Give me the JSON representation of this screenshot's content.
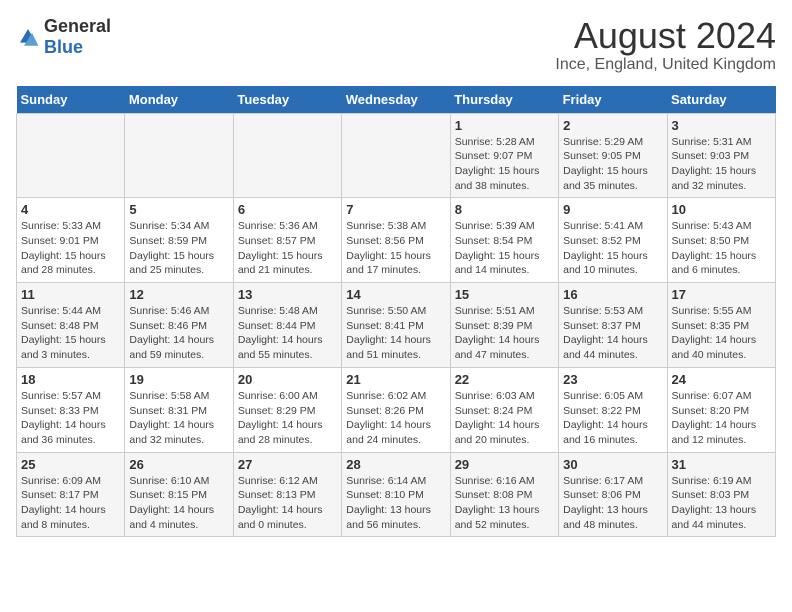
{
  "logo": {
    "general": "General",
    "blue": "Blue"
  },
  "title": "August 2024",
  "subtitle": "Ince, England, United Kingdom",
  "days_header": [
    "Sunday",
    "Monday",
    "Tuesday",
    "Wednesday",
    "Thursday",
    "Friday",
    "Saturday"
  ],
  "weeks": [
    [
      {
        "num": "",
        "info": ""
      },
      {
        "num": "",
        "info": ""
      },
      {
        "num": "",
        "info": ""
      },
      {
        "num": "",
        "info": ""
      },
      {
        "num": "1",
        "info": "Sunrise: 5:28 AM\nSunset: 9:07 PM\nDaylight: 15 hours\nand 38 minutes."
      },
      {
        "num": "2",
        "info": "Sunrise: 5:29 AM\nSunset: 9:05 PM\nDaylight: 15 hours\nand 35 minutes."
      },
      {
        "num": "3",
        "info": "Sunrise: 5:31 AM\nSunset: 9:03 PM\nDaylight: 15 hours\nand 32 minutes."
      }
    ],
    [
      {
        "num": "4",
        "info": "Sunrise: 5:33 AM\nSunset: 9:01 PM\nDaylight: 15 hours\nand 28 minutes."
      },
      {
        "num": "5",
        "info": "Sunrise: 5:34 AM\nSunset: 8:59 PM\nDaylight: 15 hours\nand 25 minutes."
      },
      {
        "num": "6",
        "info": "Sunrise: 5:36 AM\nSunset: 8:57 PM\nDaylight: 15 hours\nand 21 minutes."
      },
      {
        "num": "7",
        "info": "Sunrise: 5:38 AM\nSunset: 8:56 PM\nDaylight: 15 hours\nand 17 minutes."
      },
      {
        "num": "8",
        "info": "Sunrise: 5:39 AM\nSunset: 8:54 PM\nDaylight: 15 hours\nand 14 minutes."
      },
      {
        "num": "9",
        "info": "Sunrise: 5:41 AM\nSunset: 8:52 PM\nDaylight: 15 hours\nand 10 minutes."
      },
      {
        "num": "10",
        "info": "Sunrise: 5:43 AM\nSunset: 8:50 PM\nDaylight: 15 hours\nand 6 minutes."
      }
    ],
    [
      {
        "num": "11",
        "info": "Sunrise: 5:44 AM\nSunset: 8:48 PM\nDaylight: 15 hours\nand 3 minutes."
      },
      {
        "num": "12",
        "info": "Sunrise: 5:46 AM\nSunset: 8:46 PM\nDaylight: 14 hours\nand 59 minutes."
      },
      {
        "num": "13",
        "info": "Sunrise: 5:48 AM\nSunset: 8:44 PM\nDaylight: 14 hours\nand 55 minutes."
      },
      {
        "num": "14",
        "info": "Sunrise: 5:50 AM\nSunset: 8:41 PM\nDaylight: 14 hours\nand 51 minutes."
      },
      {
        "num": "15",
        "info": "Sunrise: 5:51 AM\nSunset: 8:39 PM\nDaylight: 14 hours\nand 47 minutes."
      },
      {
        "num": "16",
        "info": "Sunrise: 5:53 AM\nSunset: 8:37 PM\nDaylight: 14 hours\nand 44 minutes."
      },
      {
        "num": "17",
        "info": "Sunrise: 5:55 AM\nSunset: 8:35 PM\nDaylight: 14 hours\nand 40 minutes."
      }
    ],
    [
      {
        "num": "18",
        "info": "Sunrise: 5:57 AM\nSunset: 8:33 PM\nDaylight: 14 hours\nand 36 minutes."
      },
      {
        "num": "19",
        "info": "Sunrise: 5:58 AM\nSunset: 8:31 PM\nDaylight: 14 hours\nand 32 minutes."
      },
      {
        "num": "20",
        "info": "Sunrise: 6:00 AM\nSunset: 8:29 PM\nDaylight: 14 hours\nand 28 minutes."
      },
      {
        "num": "21",
        "info": "Sunrise: 6:02 AM\nSunset: 8:26 PM\nDaylight: 14 hours\nand 24 minutes."
      },
      {
        "num": "22",
        "info": "Sunrise: 6:03 AM\nSunset: 8:24 PM\nDaylight: 14 hours\nand 20 minutes."
      },
      {
        "num": "23",
        "info": "Sunrise: 6:05 AM\nSunset: 8:22 PM\nDaylight: 14 hours\nand 16 minutes."
      },
      {
        "num": "24",
        "info": "Sunrise: 6:07 AM\nSunset: 8:20 PM\nDaylight: 14 hours\nand 12 minutes."
      }
    ],
    [
      {
        "num": "25",
        "info": "Sunrise: 6:09 AM\nSunset: 8:17 PM\nDaylight: 14 hours\nand 8 minutes."
      },
      {
        "num": "26",
        "info": "Sunrise: 6:10 AM\nSunset: 8:15 PM\nDaylight: 14 hours\nand 4 minutes."
      },
      {
        "num": "27",
        "info": "Sunrise: 6:12 AM\nSunset: 8:13 PM\nDaylight: 14 hours\nand 0 minutes."
      },
      {
        "num": "28",
        "info": "Sunrise: 6:14 AM\nSunset: 8:10 PM\nDaylight: 13 hours\nand 56 minutes."
      },
      {
        "num": "29",
        "info": "Sunrise: 6:16 AM\nSunset: 8:08 PM\nDaylight: 13 hours\nand 52 minutes."
      },
      {
        "num": "30",
        "info": "Sunrise: 6:17 AM\nSunset: 8:06 PM\nDaylight: 13 hours\nand 48 minutes."
      },
      {
        "num": "31",
        "info": "Sunrise: 6:19 AM\nSunset: 8:03 PM\nDaylight: 13 hours\nand 44 minutes."
      }
    ]
  ]
}
